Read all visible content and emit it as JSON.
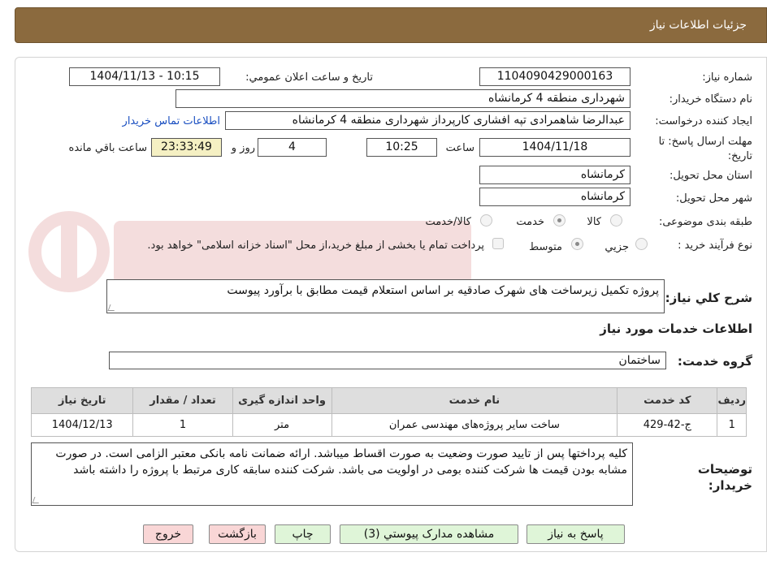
{
  "header": {
    "title": "جزئیات اطلاعات نیاز"
  },
  "form": {
    "need_number_label": "شماره نیاز:",
    "need_number": "1104090429000163",
    "announce_label": "تاریخ و ساعت اعلان عمومي:",
    "announce_value": "1404/11/13 - 10:15",
    "buyer_org_label": "نام دستگاه خريدار:",
    "buyer_org": "شهرداری منطقه 4 کرمانشاه",
    "creator_label": "ايجاد کننده درخواست:",
    "creator": "عبدالرضا شاهمرادی تپه افشاری کارپرداز شهرداری منطقه 4 کرمانشاه",
    "contact_link": "اطلاعات تماس خريدار",
    "deadline_label": "مهلت ارسال پاسخ: تا تاریخ:",
    "deadline_date": "1404/11/18",
    "time_label": "ساعت",
    "deadline_time": "10:25",
    "days_value": "4",
    "days_label": "روز و",
    "remaining_value": "23:33:49",
    "remaining_label": "ساعت باقي مانده",
    "province_label": "استان محل تحویل:",
    "province": "کرمانشاه",
    "city_label": "شهر محل تحویل:",
    "city": "کرمانشاه",
    "category_label": "طبقه بندی موضوعی:",
    "category_options": [
      "کالا",
      "خدمت",
      "کالا/خدمت"
    ],
    "category_selected": "خدمت",
    "process_label": "نوع فرآیند خرید :",
    "process_options": [
      "جزيي",
      "متوسط"
    ],
    "process_selected": "متوسط",
    "payment_note": "پرداخت تمام یا بخشی از مبلغ خرید،از محل \"اسناد خزانه اسلامی\" خواهد بود.",
    "summary_label": "شرح کلي نياز:",
    "summary": "پروژه تکمیل زیرساخت های شهرک صادقیه بر اساس استعلام قیمت مطابق با برآورد پیوست",
    "services_heading": "اطلاعات خدمات مورد نياز",
    "service_group_label": "گروه خدمت:",
    "service_group": "ساختمان"
  },
  "table": {
    "columns": [
      "رديف",
      "کد خدمت",
      "نام خدمت",
      "واحد اندازه گيری",
      "تعداد / مقدار",
      "تاريخ نياز"
    ],
    "rows": [
      [
        "1",
        "ج-42-429",
        "ساخت سایر پروژه‌های مهندسی عمران",
        "متر",
        "1",
        "1404/12/13"
      ]
    ]
  },
  "notes": {
    "label": "توضيحات خريدار:",
    "text": "کلیه پرداختها پس از تایید صورت وضعیت به صورت اقساط میباشد. ارائه ضمانت نامه بانکی معتبر الزامی است. در صورت مشابه بودن قیمت ها شرکت کننده بومی در اولویت می باشد. شرکت کننده سابقه کاری مرتبط با پروژه را داشته باشد"
  },
  "buttons": {
    "reply": "پاسخ به نياز",
    "attachments": "مشاهده مدارک پيوستي (3)",
    "print": "چاپ",
    "back": "بازگشت",
    "exit": "خروج"
  },
  "colors": {
    "header_bg": "#8b6a3e",
    "remaining_bg": "#f5f0c3",
    "link": "#1a4fc1",
    "green_button": "#dff5d8",
    "pink_button": "#f9d6d6"
  }
}
